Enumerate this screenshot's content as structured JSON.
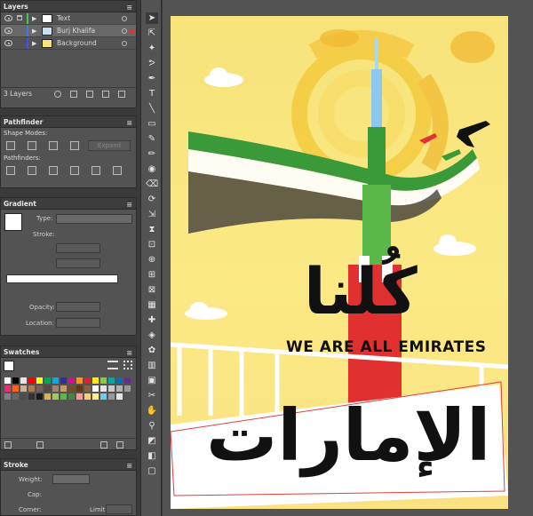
{
  "layers_panel": {
    "title": "Layers",
    "rows": [
      {
        "name": "Text",
        "color": "#4ac84a"
      },
      {
        "name": "Burj Khalifa",
        "color": "#3c78ff"
      },
      {
        "name": "Background",
        "color": "#4a4aff"
      }
    ],
    "count": "3 Layers"
  },
  "pathfinder_panel": {
    "title": "Pathfinder",
    "shape_modes_label": "Shape Modes:",
    "expand_label": "Expand",
    "pathfinders_label": "Pathfinders:"
  },
  "gradient_panel": {
    "title": "Gradient",
    "type_label": "Type:",
    "stroke_label": "Stroke:",
    "opacity_label": "Opacity:",
    "location_label": "Location:"
  },
  "swatches_panel": {
    "title": "Swatches",
    "colors": [
      "#ffffff",
      "#000000",
      "#e6e6e6",
      "#ff0000",
      "#ffff00",
      "#00a651",
      "#00aeef",
      "#2e3192",
      "#ec008c",
      "#f7941d",
      "#ed1c24",
      "#fff200",
      "#8dc63f",
      "#00a99d",
      "#0072bc",
      "#662d91",
      "#ee2a7b",
      "#f26522",
      "#c2b59b",
      "#a67c52",
      "#736357",
      "#534741",
      "#998675",
      "#c69c6d",
      "#754c24",
      "#603913",
      "#8c6239",
      "#ffffff",
      "#e6e6e6",
      "#cccccc",
      "#b3b3b3",
      "#999999",
      "#808080",
      "#666666",
      "#4d4d4d",
      "#333333",
      "#1a1a1a",
      "#d4b35a",
      "#9ecf4c",
      "#5ab848",
      "#3a8c3a",
      "#ff9999",
      "#ffcc66",
      "#ffee88",
      "#66ccff",
      "#999999",
      "#e5e5e5"
    ]
  },
  "stroke_panel": {
    "title": "Stroke",
    "weight_label": "Weight:",
    "cap_label": "Cap:",
    "corner_label": "Corner:",
    "limit_label": "Limit:"
  },
  "artwork": {
    "headline_arabic": "كُلنا",
    "tagline": "WE ARE ALL EMIRATES",
    "footer_arabic": "الإمارات",
    "colors": {
      "sky": "#f7e37a",
      "sun": "#f2c53a",
      "green": "#3a9a3a",
      "red": "#e03030",
      "tower_blue": "#8cc8f0",
      "ink": "#111111"
    }
  },
  "tools": [
    "selection",
    "direct-selection",
    "magic-wand",
    "lasso",
    "pen",
    "type",
    "line",
    "rectangle",
    "paintbrush",
    "pencil",
    "blob-brush",
    "eraser",
    "rotate",
    "scale",
    "width",
    "free-transform",
    "shape-builder",
    "perspective",
    "mesh",
    "gradient",
    "eyedropper",
    "blend",
    "symbol-sprayer",
    "column-graph",
    "artboard",
    "slice",
    "hand",
    "zoom",
    "fill-stroke",
    "draw-mode",
    "screen-mode"
  ]
}
